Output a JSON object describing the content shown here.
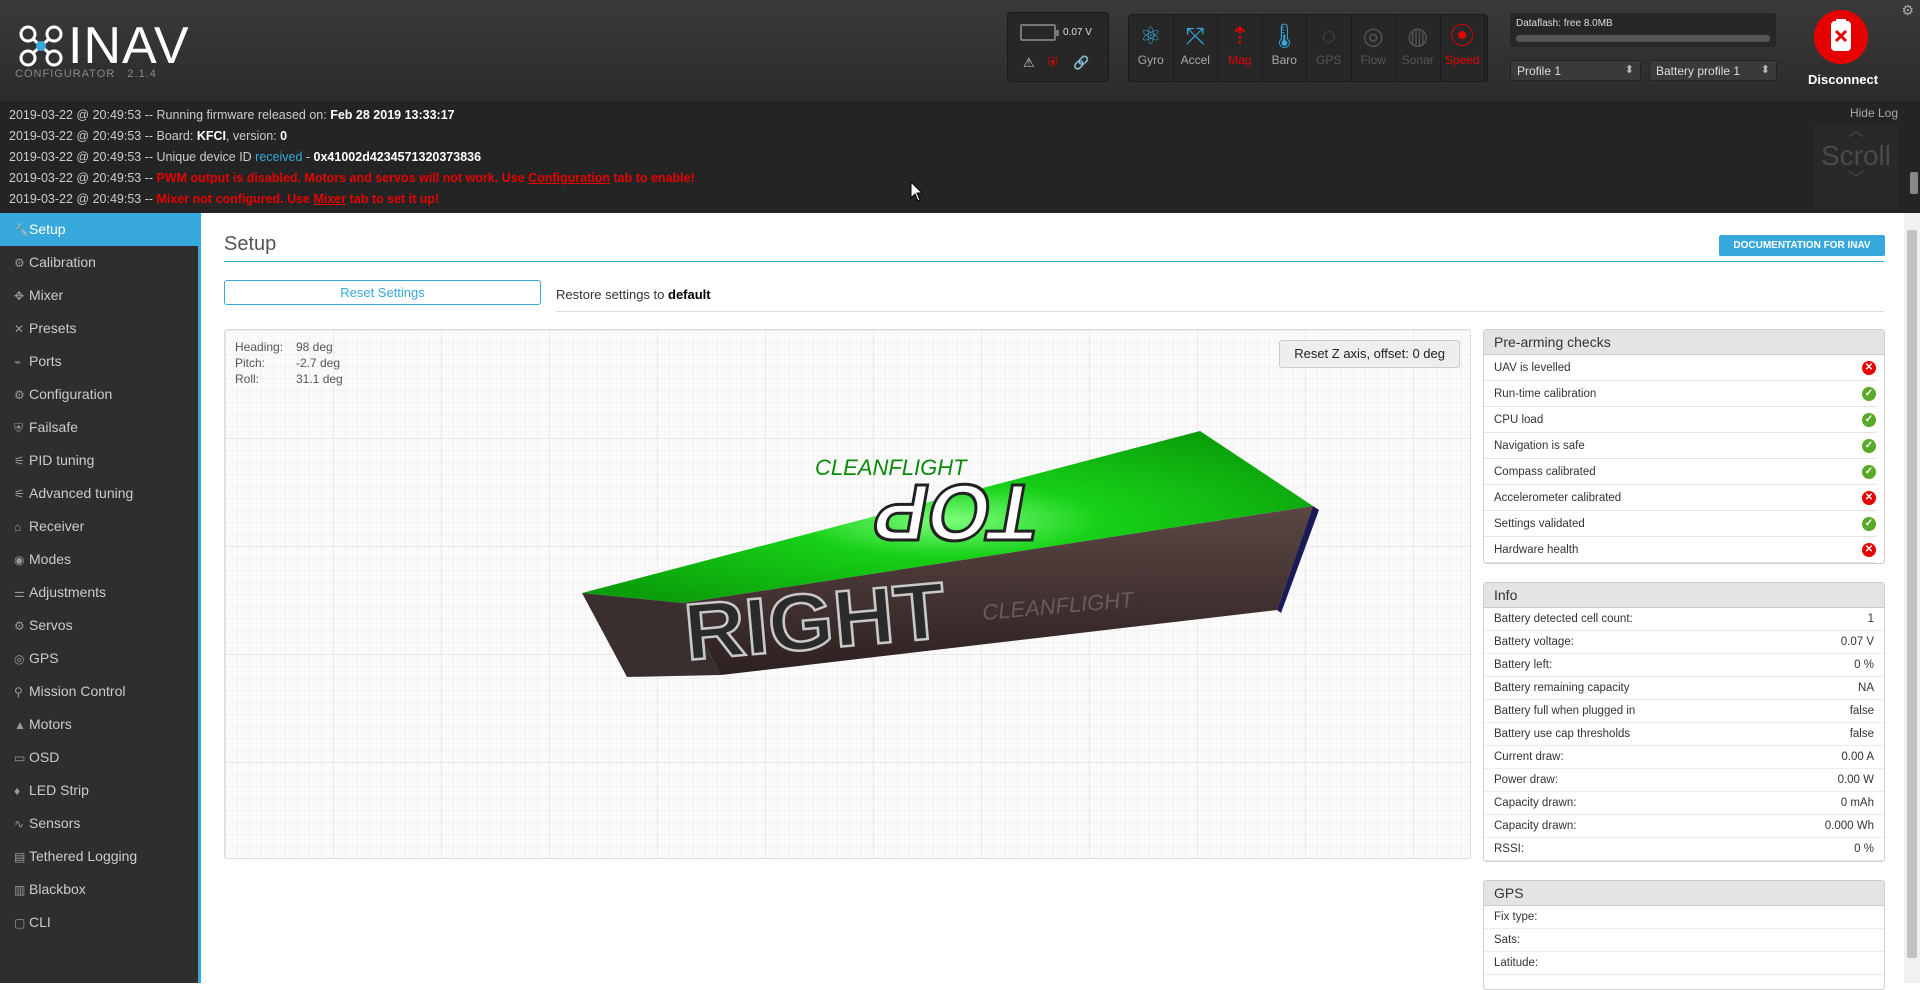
{
  "header": {
    "logo_text": "INAV",
    "subtitle": "CONFIGURATOR",
    "version": "2.1.4",
    "battery_voltage": "0.07 V",
    "sensors": [
      {
        "label": "Gyro",
        "state": "on",
        "icon": "gyro-icon"
      },
      {
        "label": "Accel",
        "state": "on",
        "icon": "accel-icon"
      },
      {
        "label": "Mag",
        "state": "err",
        "icon": "mag-icon"
      },
      {
        "label": "Baro",
        "state": "on",
        "icon": "baro-icon"
      },
      {
        "label": "GPS",
        "state": "off",
        "icon": "gps-icon"
      },
      {
        "label": "Flow",
        "state": "off",
        "icon": "flow-icon"
      },
      {
        "label": "Sonar",
        "state": "off",
        "icon": "sonar-icon"
      },
      {
        "label": "Speed",
        "state": "err",
        "icon": "speed-icon"
      }
    ],
    "dataflash_label": "Dataflash: free 8.0MB",
    "profile": "Profile 1",
    "battery_profile": "Battery profile 1",
    "disconnect_label": "Disconnect"
  },
  "log": {
    "hide_label": "Hide Log",
    "scroll_label": "Scroll",
    "lines": [
      {
        "ts": "2019-03-22 @ 20:49:53 --",
        "a": " Running firmware released on: ",
        "b": "Feb 28 2019 13:33:17"
      },
      {
        "ts": "2019-03-22 @ 20:49:53 --",
        "a": " Board: ",
        "b": "KFCI",
        "c": ", version: ",
        "d": "0"
      },
      {
        "ts": "2019-03-22 @ 20:49:53 --",
        "a": " Unique device ID ",
        "blue": "received",
        "c": " - ",
        "d": "0x41002d4234571320373836"
      },
      {
        "ts": "2019-03-22 @ 20:49:53 --",
        "r1": " PWM output is disabled. Motors and servos will not work. Use ",
        "link": "Configuration",
        "r2": " tab to enable!"
      },
      {
        "ts": "2019-03-22 @ 20:49:53 --",
        "r1": " Mixer not configured. Use ",
        "link": "Mixer",
        "r2": " tab to set it up!"
      }
    ]
  },
  "nav": [
    {
      "label": "Setup",
      "icon": "wrench-icon",
      "glyph": "🔧"
    },
    {
      "label": "Calibration",
      "icon": "calibration-icon",
      "glyph": "⚙"
    },
    {
      "label": "Mixer",
      "icon": "mixer-icon",
      "glyph": "✥"
    },
    {
      "label": "Presets",
      "icon": "presets-icon",
      "glyph": "✕"
    },
    {
      "label": "Ports",
      "icon": "ports-icon",
      "glyph": "⌁"
    },
    {
      "label": "Configuration",
      "icon": "configuration-icon",
      "glyph": "⚙"
    },
    {
      "label": "Failsafe",
      "icon": "failsafe-icon",
      "glyph": "⛨"
    },
    {
      "label": "PID tuning",
      "icon": "pid-icon",
      "glyph": "⚟"
    },
    {
      "label": "Advanced tuning",
      "icon": "advanced-tuning-icon",
      "glyph": "⚟"
    },
    {
      "label": "Receiver",
      "icon": "receiver-icon",
      "glyph": "⌂"
    },
    {
      "label": "Modes",
      "icon": "modes-icon",
      "glyph": "◉"
    },
    {
      "label": "Adjustments",
      "icon": "adjustments-icon",
      "glyph": "⚌"
    },
    {
      "label": "Servos",
      "icon": "servos-icon",
      "glyph": "⚙"
    },
    {
      "label": "GPS",
      "icon": "gps-nav-icon",
      "glyph": "◎"
    },
    {
      "label": "Mission Control",
      "icon": "mission-control-icon",
      "glyph": "⚲"
    },
    {
      "label": "Motors",
      "icon": "motors-icon",
      "glyph": "▲"
    },
    {
      "label": "OSD",
      "icon": "osd-icon",
      "glyph": "▭"
    },
    {
      "label": "LED Strip",
      "icon": "led-strip-icon",
      "glyph": "♦"
    },
    {
      "label": "Sensors",
      "icon": "sensors-icon",
      "glyph": "∿"
    },
    {
      "label": "Tethered Logging",
      "icon": "tethered-logging-icon",
      "glyph": "▤"
    },
    {
      "label": "Blackbox",
      "icon": "blackbox-icon",
      "glyph": "▥"
    },
    {
      "label": "CLI",
      "icon": "cli-icon",
      "glyph": "▢"
    }
  ],
  "content": {
    "title": "Setup",
    "doc_button": "DOCUMENTATION FOR INAV",
    "reset_button": "Reset Settings",
    "restore_prefix": "Restore settings to ",
    "restore_value": "default",
    "attitude": {
      "heading_label": "Heading:",
      "heading": "98 deg",
      "pitch_label": "Pitch:",
      "pitch": "-2.7 deg",
      "roll_label": "Roll:",
      "roll": "31.1 deg"
    },
    "reset_z_button": "Reset Z axis, offset: 0 deg",
    "model_top_text": "TOP",
    "model_side_text": "RIGHT",
    "model_logo_text": "CLEANFLIGHT"
  },
  "prearm": {
    "title": "Pre-arming checks",
    "checks": [
      {
        "label": "UAV is levelled",
        "ok": false
      },
      {
        "label": "Run-time calibration",
        "ok": true
      },
      {
        "label": "CPU load",
        "ok": true
      },
      {
        "label": "Navigation is safe",
        "ok": true
      },
      {
        "label": "Compass calibrated",
        "ok": true
      },
      {
        "label": "Accelerometer calibrated",
        "ok": false
      },
      {
        "label": "Settings validated",
        "ok": true
      },
      {
        "label": "Hardware health",
        "ok": false
      }
    ]
  },
  "info": {
    "title": "Info",
    "rows": [
      {
        "label": "Battery detected cell count:",
        "value": "1"
      },
      {
        "label": "Battery voltage:",
        "value": "0.07 V"
      },
      {
        "label": "Battery left:",
        "value": "0 %"
      },
      {
        "label": "Battery remaining capacity",
        "value": "NA"
      },
      {
        "label": "Battery full when plugged in",
        "value": "false"
      },
      {
        "label": "Battery use cap thresholds",
        "value": "false"
      },
      {
        "label": "Current draw:",
        "value": "0.00 A"
      },
      {
        "label": "Power draw:",
        "value": "0.00 W"
      },
      {
        "label": "Capacity drawn:",
        "value": "0 mAh"
      },
      {
        "label": "Capacity drawn:",
        "value": "0.000 Wh"
      },
      {
        "label": "RSSI:",
        "value": "0 %"
      }
    ]
  },
  "gps": {
    "title": "GPS",
    "rows": [
      {
        "label": "Fix type:",
        "value": ""
      },
      {
        "label": "Sats:",
        "value": ""
      },
      {
        "label": "Latitude:",
        "value": ""
      }
    ]
  },
  "colors": {
    "accent": "#37a8db",
    "ok": "#59aa29",
    "error": "#e60000",
    "header_bg": "#2f2f2f",
    "sidebar_bg": "#2e2e2e"
  }
}
